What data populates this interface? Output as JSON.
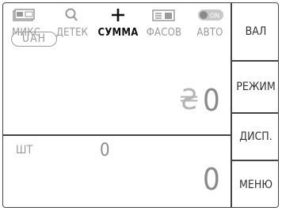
{
  "modes": [
    {
      "label": "МИКС",
      "icon": "banknote-denomination-icon",
      "active": false
    },
    {
      "label": "ДЕТЕК",
      "icon": "magnifier-icon",
      "active": false
    },
    {
      "label": "СУММА",
      "icon": "plus-icon",
      "active": true
    },
    {
      "label": "ФАСОВ",
      "icon": "banknote-batch-icon",
      "active": false
    },
    {
      "label": "АВТО",
      "icon": "toggle-on-icon",
      "toggle_text": "ON",
      "active": false
    }
  ],
  "side_menu": {
    "currency_button": "ВАЛ",
    "mode_button": "РЕЖИМ",
    "display_button": "ДИСП.",
    "menu_button": "МЕНЮ"
  },
  "amount": {
    "currency_code": "UAH",
    "currency_symbol": "₴",
    "value": "0"
  },
  "counter": {
    "label": "ШТ",
    "count": "0",
    "total": "0"
  },
  "colors": {
    "border": "#444444",
    "inactive_text": "#9a9a9a",
    "active_text": "#111111",
    "value_text": "#8a8a8a"
  }
}
